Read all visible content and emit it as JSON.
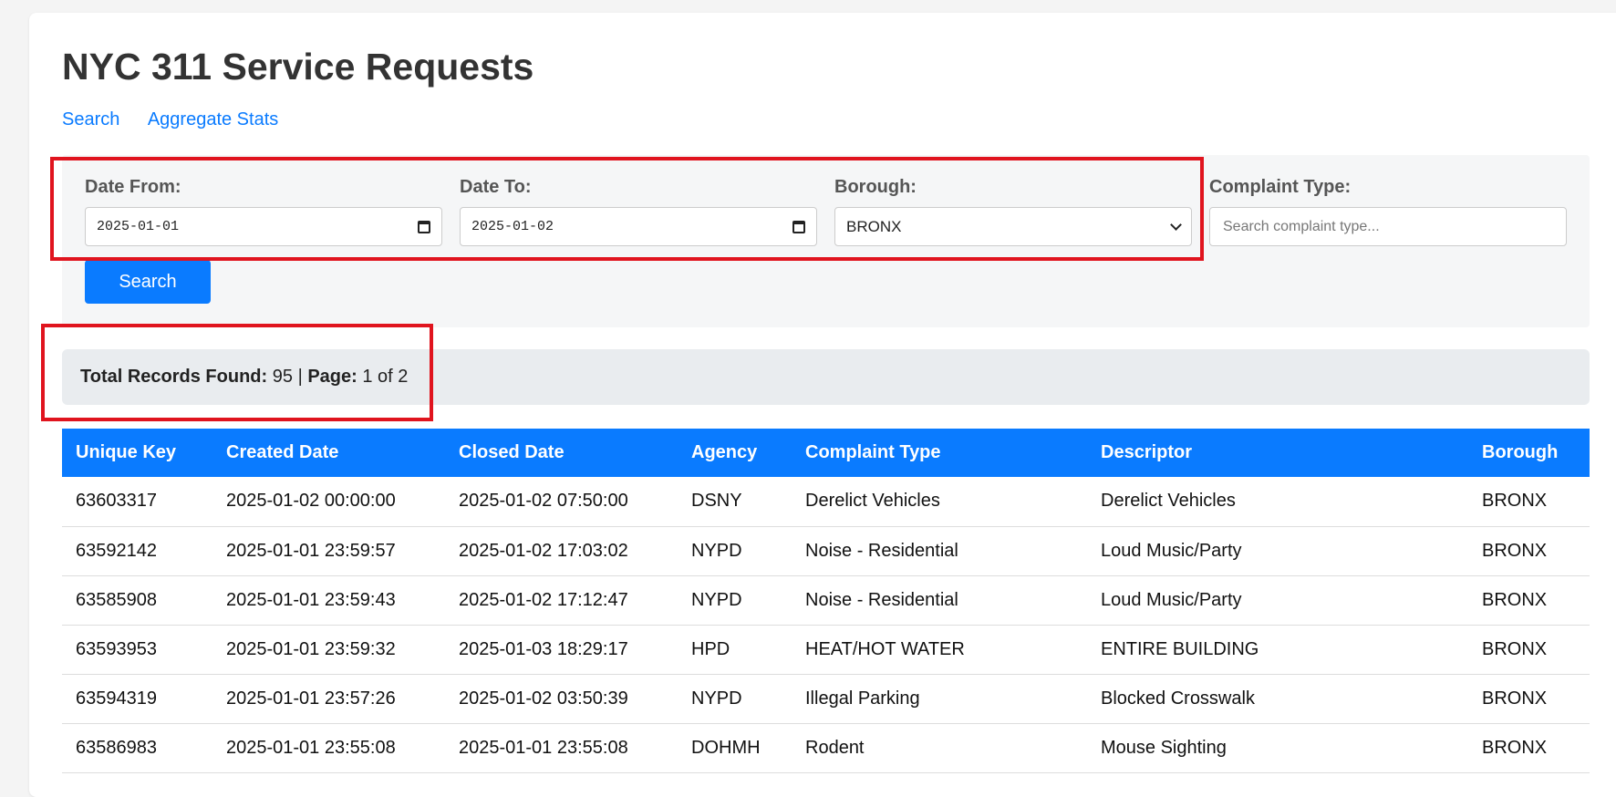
{
  "header": {
    "title": "NYC 311 Service Requests"
  },
  "nav": {
    "search": "Search",
    "aggregate": "Aggregate Stats"
  },
  "filters": {
    "date_from_label": "Date From:",
    "date_from_value": "2025-01-01",
    "date_to_label": "Date To:",
    "date_to_value": "2025-01-02",
    "borough_label": "Borough:",
    "borough_value": "BRONX",
    "complaint_label": "Complaint Type:",
    "complaint_placeholder": "Search complaint type...",
    "search_button": "Search"
  },
  "summary": {
    "total_label": "Total Records Found:",
    "total_value": "95",
    "separator": "|",
    "page_label": "Page:",
    "page_value": "1 of 2"
  },
  "table": {
    "headers": [
      "Unique Key",
      "Created Date",
      "Closed Date",
      "Agency",
      "Complaint Type",
      "Descriptor",
      "Borough"
    ],
    "rows": [
      [
        "63603317",
        "2025-01-02 00:00:00",
        "2025-01-02 07:50:00",
        "DSNY",
        "Derelict Vehicles",
        "Derelict Vehicles",
        "BRONX"
      ],
      [
        "63592142",
        "2025-01-01 23:59:57",
        "2025-01-02 17:03:02",
        "NYPD",
        "Noise - Residential",
        "Loud Music/Party",
        "BRONX"
      ],
      [
        "63585908",
        "2025-01-01 23:59:43",
        "2025-01-02 17:12:47",
        "NYPD",
        "Noise - Residential",
        "Loud Music/Party",
        "BRONX"
      ],
      [
        "63593953",
        "2025-01-01 23:59:32",
        "2025-01-03 18:29:17",
        "HPD",
        "HEAT/HOT WATER",
        "ENTIRE BUILDING",
        "BRONX"
      ],
      [
        "63594319",
        "2025-01-01 23:57:26",
        "2025-01-02 03:50:39",
        "NYPD",
        "Illegal Parking",
        "Blocked Crosswalk",
        "BRONX"
      ],
      [
        "63586983",
        "2025-01-01 23:55:08",
        "2025-01-01 23:55:08",
        "DOHMH",
        "Rodent",
        "Mouse Sighting",
        "BRONX"
      ]
    ]
  },
  "colors": {
    "accent": "#0a7bff",
    "highlight": "#e0141e",
    "panel": "#f5f6f7",
    "summary_bg": "#e9ecef"
  }
}
